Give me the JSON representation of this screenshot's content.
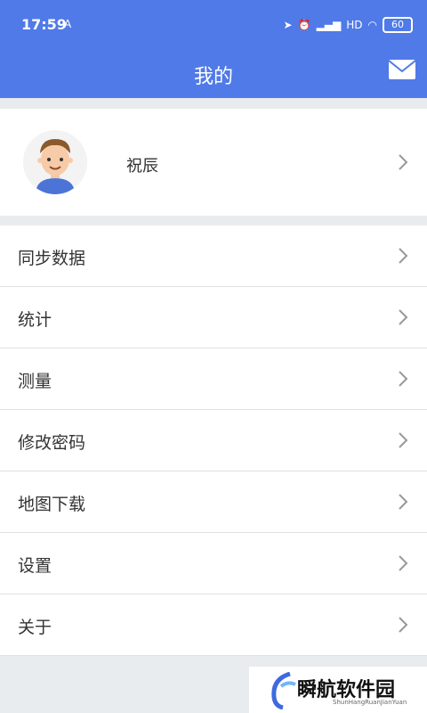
{
  "status_bar": {
    "time": "17:59",
    "warning_symbol": "A",
    "network": "HD",
    "battery": "60"
  },
  "app_bar": {
    "title": "我的",
    "mail_icon": "mail-icon"
  },
  "profile": {
    "name": "祝辰",
    "avatar_icon": "user-avatar"
  },
  "menu": [
    {
      "label": "同步数据"
    },
    {
      "label": "统计"
    },
    {
      "label": "测量"
    },
    {
      "label": "修改密码"
    },
    {
      "label": "地图下载"
    },
    {
      "label": "设置"
    },
    {
      "label": "关于"
    }
  ],
  "watermark": {
    "text": "瞬航软件园",
    "subtext": "ShunHangRuanJianYuan"
  },
  "colors": {
    "accent": "#4f7ae8",
    "background": "#e8ecef",
    "text": "#333333"
  }
}
